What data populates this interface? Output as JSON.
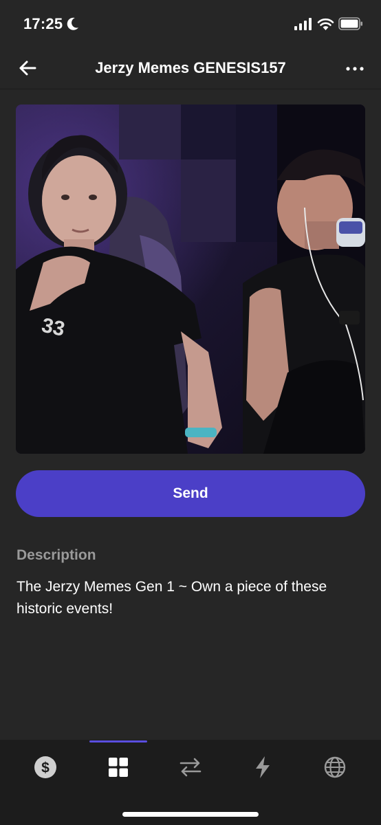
{
  "status": {
    "time": "17:25"
  },
  "header": {
    "title": "Jerzy Memes GENESIS157"
  },
  "media": {
    "alt": ""
  },
  "actions": {
    "send_label": "Send"
  },
  "description": {
    "label": "Description",
    "text": "The Jerzy Memes Gen 1 ~ Own a piece of these historic events!"
  },
  "tabs": [
    {
      "icon": "dollar-icon",
      "active": false
    },
    {
      "icon": "grid-icon",
      "active": true
    },
    {
      "icon": "transfer-icon",
      "active": false
    },
    {
      "icon": "lightning-icon",
      "active": false
    },
    {
      "icon": "globe-icon",
      "active": false
    }
  ],
  "colors": {
    "background": "#262626",
    "tab_bar": "#1c1c1c",
    "accent": "#4b3fc7",
    "muted_text": "#9a9a9a"
  }
}
